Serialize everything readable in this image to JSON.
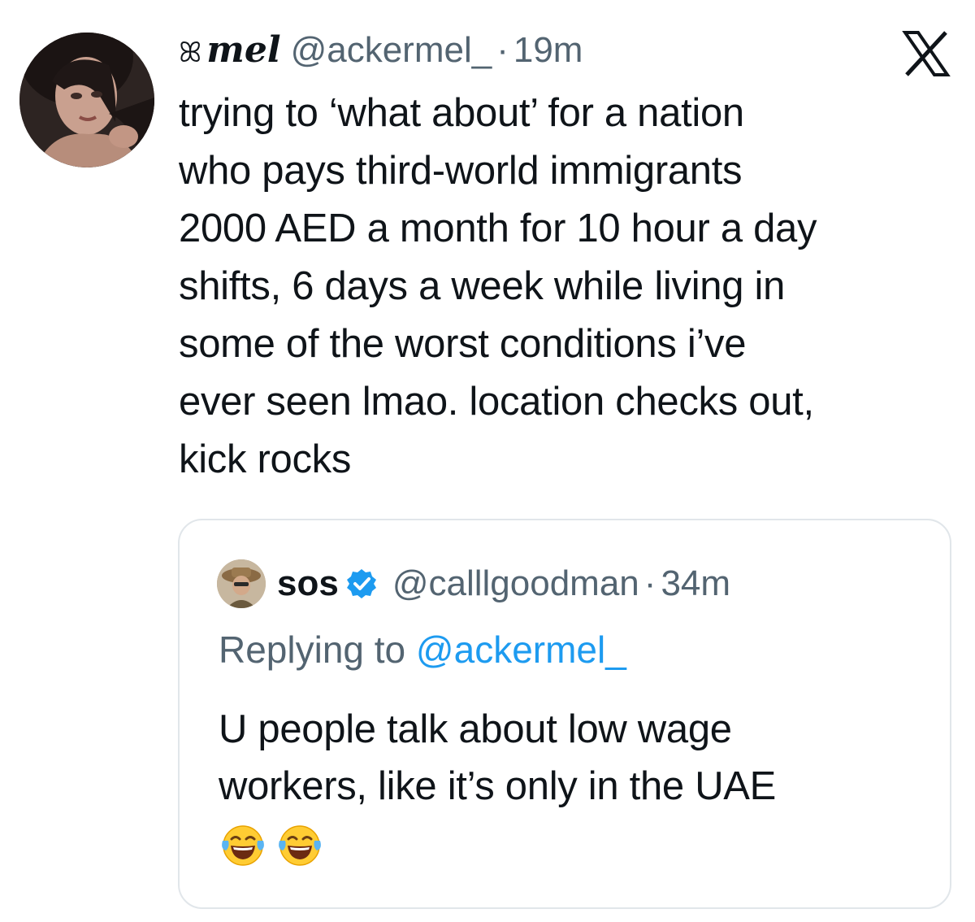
{
  "tweet": {
    "name_symbol": "ꕤ",
    "display_name": "mel",
    "handle": "@ackermel_",
    "separator": "·",
    "time": "19m",
    "text_lines": [
      "trying to ‘what about’ for a nation",
      "who pays third-world immigrants",
      "2000 AED a month for 10 hour a day",
      "shifts, 6 days a week while living in",
      "some of the worst conditions i’ve",
      "ever seen lmao. location checks out,",
      "kick rocks"
    ],
    "logo_icon": "x-logo-icon"
  },
  "quote": {
    "display_name": "sos",
    "verified": true,
    "handle": "@calllgoodman",
    "separator": "·",
    "time": "34m",
    "replying_prefix": "Replying to",
    "replying_to": "@ackermel_",
    "text_lines": [
      "U people talk about low wage",
      "workers, like it’s only in the UAE"
    ],
    "emojis": [
      "face-with-tears-of-joy",
      "face-with-tears-of-joy"
    ]
  },
  "colors": {
    "text": "#0f1419",
    "secondary": "#536471",
    "link": "#1d9bf0",
    "verified": "#1d9bf0",
    "border": "#e1e6ea"
  }
}
